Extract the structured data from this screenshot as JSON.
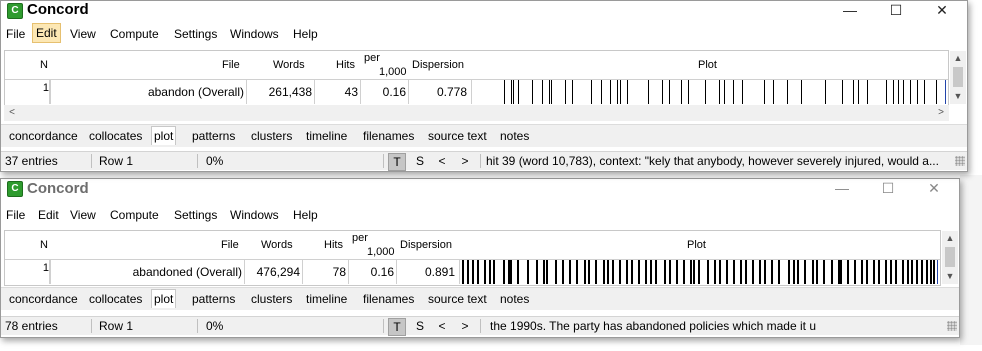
{
  "windows": [
    {
      "title": "Concord",
      "menu": [
        "File",
        "Edit",
        "View",
        "Compute",
        "Settings",
        "Windows",
        "Help"
      ],
      "active_menu": "Edit",
      "columns": {
        "n": "N",
        "file": "File",
        "words": "Words",
        "hits": "Hits",
        "per_top": "per",
        "per_bottom": "1,000",
        "dispersion": "Dispersion",
        "plot": "Plot"
      },
      "row": {
        "n": "1",
        "file": "abandon (Overall)",
        "words": "261,438",
        "hits": "43",
        "per": "0.16",
        "dispersion": "0.778"
      },
      "plot_hits": [
        0.07,
        0.085,
        0.09,
        0.1,
        0.13,
        0.15,
        0.165,
        0.17,
        0.2,
        0.215,
        0.255,
        0.275,
        0.295,
        0.31,
        0.315,
        0.33,
        0.375,
        0.405,
        0.42,
        0.445,
        0.46,
        0.495,
        0.525,
        0.535,
        0.555,
        0.575,
        0.62,
        0.64,
        0.67,
        0.7,
        0.75,
        0.785,
        0.81,
        0.82,
        0.84,
        0.88,
        0.895,
        0.905,
        0.915,
        0.93,
        0.945,
        0.96,
        0.985
      ],
      "tabs": [
        "concordance",
        "collocates",
        "plot",
        "patterns",
        "clusters",
        "timeline",
        "filenames",
        "source text",
        "notes"
      ],
      "selected_tab": "plot",
      "status": {
        "entries": "37 entries",
        "row": "Row 1",
        "percent": "0%",
        "t": "T",
        "s": "S",
        "prev": "<",
        "next": ">",
        "context": "hit 39 (word 10,783), context: \"kely that anybody, however severely injured, would a..."
      }
    },
    {
      "title": "Concord",
      "menu": [
        "File",
        "Edit",
        "View",
        "Compute",
        "Settings",
        "Windows",
        "Help"
      ],
      "active_menu": "",
      "columns": {
        "n": "N",
        "file": "File",
        "words": "Words",
        "hits": "Hits",
        "per_top": "per",
        "per_bottom": "1,000",
        "dispersion": "Dispersion",
        "plot": "Plot"
      },
      "row": {
        "n": "1",
        "file": "abandoned (Overall)",
        "words": "476,294",
        "hits": "78",
        "per": "0.16",
        "dispersion": "0.891"
      },
      "plot_hits": [
        0.005,
        0.015,
        0.025,
        0.035,
        0.05,
        0.06,
        0.07,
        0.09,
        0.1,
        0.105,
        0.12,
        0.14,
        0.16,
        0.175,
        0.18,
        0.2,
        0.215,
        0.23,
        0.245,
        0.26,
        0.27,
        0.285,
        0.3,
        0.31,
        0.32,
        0.335,
        0.35,
        0.36,
        0.375,
        0.39,
        0.4,
        0.41,
        0.43,
        0.44,
        0.455,
        0.47,
        0.485,
        0.49,
        0.5,
        0.52,
        0.535,
        0.545,
        0.56,
        0.575,
        0.59,
        0.6,
        0.615,
        0.63,
        0.64,
        0.655,
        0.67,
        0.69,
        0.7,
        0.71,
        0.725,
        0.74,
        0.75,
        0.765,
        0.78,
        0.795,
        0.8,
        0.815,
        0.83,
        0.845,
        0.855,
        0.87,
        0.88,
        0.895,
        0.905,
        0.915,
        0.93,
        0.94,
        0.95,
        0.96,
        0.97,
        0.98,
        0.99,
        0.995
      ],
      "tabs": [
        "concordance",
        "collocates",
        "plot",
        "patterns",
        "clusters",
        "timeline",
        "filenames",
        "source text",
        "notes"
      ],
      "selected_tab": "plot",
      "status": {
        "entries": "78 entries",
        "row": "Row 1",
        "percent": "0%",
        "t": "T",
        "s": "S",
        "prev": "<",
        "next": ">",
        "context": "the 1990s. The party has abandoned policies which made it u"
      }
    }
  ],
  "window_buttons": {
    "minimize": "—",
    "maximize": "☐",
    "close": "✕"
  }
}
